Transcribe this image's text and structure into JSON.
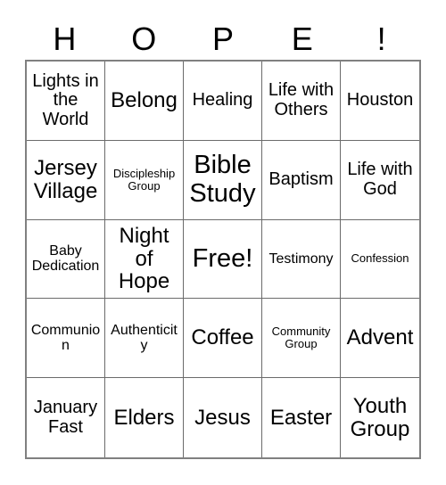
{
  "card": {
    "title_letters": [
      "H",
      "O",
      "P",
      "E",
      "!"
    ],
    "grid": {
      "rows": 5,
      "columns": 5,
      "border_color": "#808080",
      "cell_border_color": "#6b6b6b",
      "background_color": "#ffffff",
      "text_color": "#000000",
      "free_space": {
        "row": 3,
        "column": 3,
        "label": "Free!"
      },
      "cells": [
        [
          {
            "label": "Lights in the World",
            "size": "md"
          },
          {
            "label": "Belong",
            "size": "lg"
          },
          {
            "label": "Healing",
            "size": "md"
          },
          {
            "label": "Life with Others",
            "size": "md"
          },
          {
            "label": "Houston",
            "size": "md"
          }
        ],
        [
          {
            "label": "Jersey Village",
            "size": "lg"
          },
          {
            "label": "Discipleship Group",
            "size": "xs"
          },
          {
            "label": "Bible Study",
            "size": "xl"
          },
          {
            "label": "Baptism",
            "size": "md"
          },
          {
            "label": "Life with God",
            "size": "md"
          }
        ],
        [
          {
            "label": "Baby Dedication",
            "size": "sm"
          },
          {
            "label": "Night of Hope",
            "size": "lg"
          },
          {
            "label": "Free!",
            "size": "xl"
          },
          {
            "label": "Testimony",
            "size": "sm"
          },
          {
            "label": "Confession",
            "size": "xs"
          }
        ],
        [
          {
            "label": "Communion",
            "size": "sm"
          },
          {
            "label": "Authenticity",
            "size": "sm"
          },
          {
            "label": "Coffee",
            "size": "lg"
          },
          {
            "label": "Community Group",
            "size": "xs"
          },
          {
            "label": "Advent",
            "size": "lg"
          }
        ],
        [
          {
            "label": "January Fast",
            "size": "md"
          },
          {
            "label": "Elders",
            "size": "lg"
          },
          {
            "label": "Jesus",
            "size": "lg"
          },
          {
            "label": "Easter",
            "size": "lg"
          },
          {
            "label": "Youth Group",
            "size": "lg"
          }
        ]
      ]
    }
  }
}
